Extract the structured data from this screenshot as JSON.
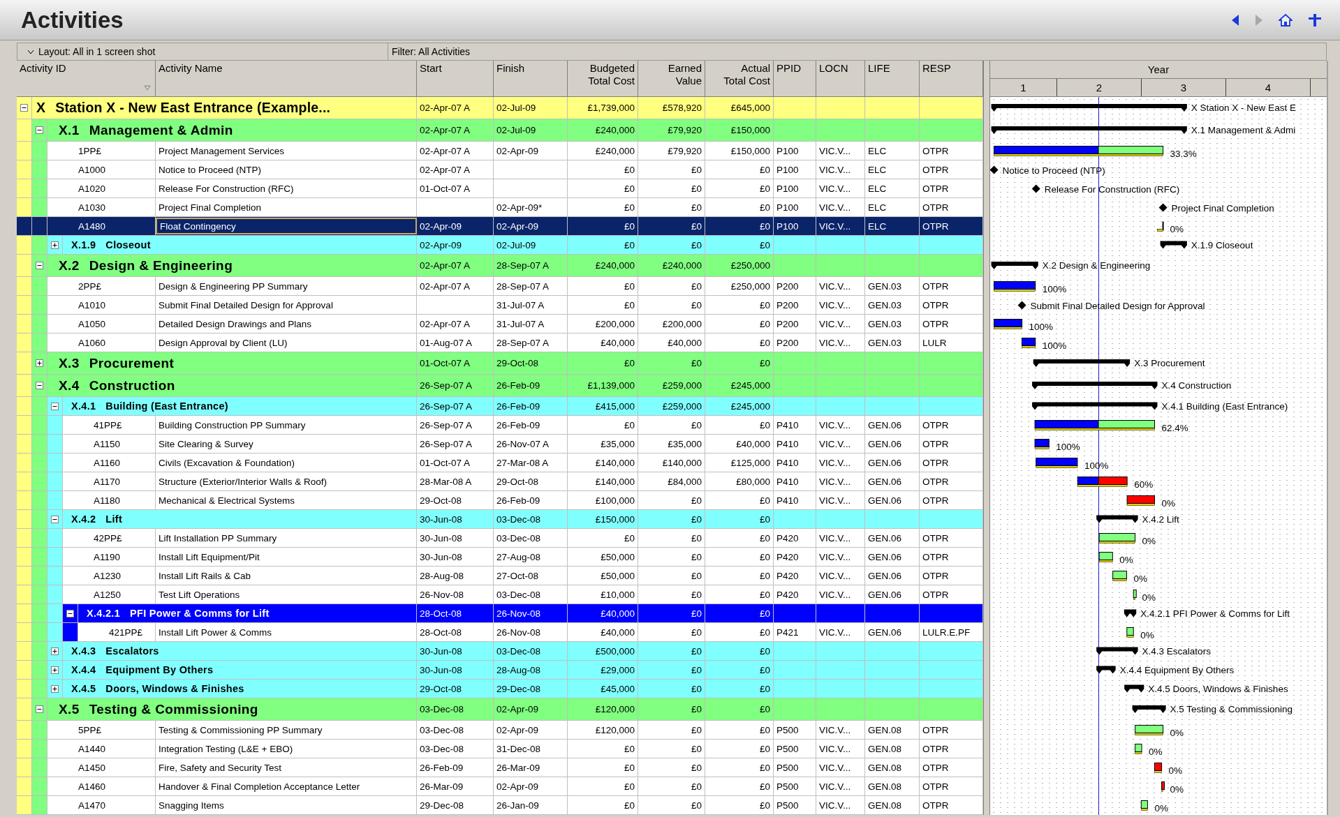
{
  "title": "Activities",
  "toolbar": {
    "layout": "Layout: All in 1 screen shot",
    "filter": "Filter: All Activities"
  },
  "columns": [
    {
      "lines": [
        "Activity ID"
      ]
    },
    {
      "lines": [
        "Activity Name"
      ]
    },
    {
      "lines": [
        "Start"
      ]
    },
    {
      "lines": [
        "Finish"
      ]
    },
    {
      "lines": [
        "Budgeted",
        "Total Cost"
      ]
    },
    {
      "lines": [
        "Earned",
        "Value"
      ]
    },
    {
      "lines": [
        "Actual",
        "Total Cost"
      ]
    },
    {
      "lines": [
        "PPID"
      ]
    },
    {
      "lines": [
        "LOCN"
      ]
    },
    {
      "lines": [
        "LIFE"
      ]
    },
    {
      "lines": [
        "RESP"
      ]
    }
  ],
  "timescale": {
    "title": "Year",
    "ticks": [
      "1",
      "2",
      "3",
      "4"
    ]
  },
  "activities": [
    {
      "kind": "wbs",
      "code": "X",
      "name": "Station X - New East Entrance (Example...",
      "start": "02-Apr-07 A",
      "finish": "02-Jul-09",
      "budgeted": "£1,739,000",
      "earned": "£578,920",
      "actual": "£645,000",
      "expanded": true,
      "selected": false,
      "bar": {
        "kind": "summary",
        "label": "X Station X - New East E"
      },
      "children": [
        {
          "kind": "wbs",
          "code": "X.1",
          "name": "Management & Admin",
          "start": "02-Apr-07 A",
          "finish": "02-Jul-09",
          "budgeted": "£240,000",
          "earned": "£79,920",
          "actual": "£150,000",
          "expanded": true,
          "selected": false,
          "bar": {
            "kind": "summary",
            "label": "X.1 Management & Admi"
          },
          "children": [
            {
              "kind": "task",
              "id": "1PP£",
              "name": "Project Management Services",
              "start": "02-Apr-07 A",
              "finish": "02-Apr-09",
              "budgeted": "£240,000",
              "earned": "£79,920",
              "actual": "£150,000",
              "ppid": "P100",
              "locn": "VIC.V...",
              "life": "ELC",
              "resp": "OTPR",
              "selected": false,
              "bar": {
                "kind": "task",
                "label": "33.3%"
              }
            },
            {
              "kind": "task",
              "id": "A1000",
              "name": "Notice to Proceed (NTP)",
              "start": "02-Apr-07 A",
              "budgeted": "£0",
              "earned": "£0",
              "actual": "£0",
              "ppid": "P100",
              "locn": "VIC.V...",
              "life": "ELC",
              "resp": "OTPR",
              "selected": false,
              "bar": {
                "kind": "milestone",
                "label": "Notice to Proceed (NTP)"
              }
            },
            {
              "kind": "task",
              "id": "A1020",
              "name": "Release For Construction (RFC)",
              "start": "01-Oct-07 A",
              "budgeted": "£0",
              "earned": "£0",
              "actual": "£0",
              "ppid": "P100",
              "locn": "VIC.V...",
              "life": "ELC",
              "resp": "OTPR",
              "selected": false,
              "bar": {
                "kind": "milestone",
                "label": "Release For Construction (RFC)"
              }
            },
            {
              "kind": "task",
              "id": "A1030",
              "name": "Project Final Completion",
              "finish": "02-Apr-09*",
              "budgeted": "£0",
              "earned": "£0",
              "actual": "£0",
              "ppid": "P100",
              "locn": "VIC.V...",
              "life": "ELC",
              "resp": "OTPR",
              "selected": false,
              "bar": {
                "kind": "milestone",
                "label": "Project Final Completion"
              }
            },
            {
              "kind": "task",
              "id": "A1480",
              "name": "Float Contingency",
              "start": "02-Apr-09",
              "finish": "02-Apr-09",
              "budgeted": "£0",
              "earned": "£0",
              "actual": "£0",
              "ppid": "P100",
              "locn": "VIC.V...",
              "life": "ELC",
              "resp": "OTPR",
              "selected": true,
              "bar": {
                "kind": "task",
                "label": "0%"
              }
            },
            {
              "kind": "wbs",
              "code": "X.1.9",
              "name": "Closeout",
              "start": "02-Apr-09",
              "finish": "02-Jul-09",
              "budgeted": "£0",
              "earned": "£0",
              "actual": "£0",
              "expanded": false,
              "selected": false,
              "bar": {
                "kind": "summary",
                "label": "X.1.9 Closeout"
              }
            }
          ]
        },
        {
          "kind": "wbs",
          "code": "X.2",
          "name": "Design & Engineering",
          "start": "02-Apr-07 A",
          "finish": "28-Sep-07 A",
          "budgeted": "£240,000",
          "earned": "£240,000",
          "actual": "£250,000",
          "expanded": true,
          "selected": false,
          "bar": {
            "kind": "summary",
            "label": "X.2 Design & Engineering"
          },
          "children": [
            {
              "kind": "task",
              "id": "2PP£",
              "name": "Design & Engineering PP Summary",
              "start": "02-Apr-07 A",
              "finish": "28-Sep-07 A",
              "budgeted": "£0",
              "earned": "£0",
              "actual": "£250,000",
              "ppid": "P200",
              "locn": "VIC.V...",
              "life": "GEN.03",
              "resp": "OTPR",
              "selected": false,
              "bar": {
                "kind": "task",
                "label": "100%"
              }
            },
            {
              "kind": "task",
              "id": "A1010",
              "name": "Submit Final Detailed Design for Approval",
              "finish": "31-Jul-07 A",
              "budgeted": "£0",
              "earned": "£0",
              "actual": "£0",
              "ppid": "P200",
              "locn": "VIC.V...",
              "life": "GEN.03",
              "resp": "OTPR",
              "selected": false,
              "bar": {
                "kind": "milestone",
                "label": "Submit Final Detailed Design for Approval"
              }
            },
            {
              "kind": "task",
              "id": "A1050",
              "name": "Detailed Design Drawings and Plans",
              "start": "02-Apr-07 A",
              "finish": "31-Jul-07 A",
              "budgeted": "£200,000",
              "earned": "£200,000",
              "actual": "£0",
              "ppid": "P200",
              "locn": "VIC.V...",
              "life": "GEN.03",
              "resp": "OTPR",
              "selected": false,
              "bar": {
                "kind": "task",
                "label": "100%"
              }
            },
            {
              "kind": "task",
              "id": "A1060",
              "name": "Design Approval by Client (LU)",
              "start": "01-Aug-07 A",
              "finish": "28-Sep-07 A",
              "budgeted": "£40,000",
              "earned": "£40,000",
              "actual": "£0",
              "ppid": "P200",
              "locn": "VIC.V...",
              "life": "GEN.03",
              "resp": "LULR",
              "selected": false,
              "bar": {
                "kind": "task",
                "label": "100%"
              }
            }
          ]
        },
        {
          "kind": "wbs",
          "code": "X.3",
          "name": "Procurement",
          "start": "01-Oct-07 A",
          "finish": "29-Oct-08",
          "budgeted": "£0",
          "earned": "£0",
          "actual": "£0",
          "expanded": false,
          "selected": false,
          "bar": {
            "kind": "summary",
            "label": "X.3 Procurement"
          }
        },
        {
          "kind": "wbs",
          "code": "X.4",
          "name": "Construction",
          "start": "26-Sep-07 A",
          "finish": "26-Feb-09",
          "budgeted": "£1,139,000",
          "earned": "£259,000",
          "actual": "£245,000",
          "expanded": true,
          "selected": false,
          "bar": {
            "kind": "summary",
            "label": "X.4 Construction"
          },
          "children": [
            {
              "kind": "wbs",
              "code": "X.4.1",
              "name": "Building (East Entrance)",
              "start": "26-Sep-07 A",
              "finish": "26-Feb-09",
              "budgeted": "£415,000",
              "earned": "£259,000",
              "actual": "£245,000",
              "expanded": true,
              "selected": false,
              "bar": {
                "kind": "summary",
                "label": "X.4.1 Building (East Entrance)"
              },
              "children": [
                {
                  "kind": "task",
                  "id": "41PP£",
                  "name": "Building Construction PP Summary",
                  "start": "26-Sep-07 A",
                  "finish": "26-Feb-09",
                  "budgeted": "£0",
                  "earned": "£0",
                  "actual": "£0",
                  "ppid": "P410",
                  "locn": "VIC.V...",
                  "life": "GEN.06",
                  "resp": "OTPR",
                  "selected": false,
                  "bar": {
                    "kind": "task",
                    "label": "62.4%"
                  }
                },
                {
                  "kind": "task",
                  "id": "A1150",
                  "name": "Site Clearing & Survey",
                  "start": "26-Sep-07 A",
                  "finish": "26-Nov-07 A",
                  "budgeted": "£35,000",
                  "earned": "£35,000",
                  "actual": "£40,000",
                  "ppid": "P410",
                  "locn": "VIC.V...",
                  "life": "GEN.06",
                  "resp": "OTPR",
                  "selected": false,
                  "bar": {
                    "kind": "task",
                    "label": "100%"
                  }
                },
                {
                  "kind": "task",
                  "id": "A1160",
                  "name": "Civils (Excavation & Foundation)",
                  "start": "01-Oct-07 A",
                  "finish": "27-Mar-08 A",
                  "budgeted": "£140,000",
                  "earned": "£140,000",
                  "actual": "£125,000",
                  "ppid": "P410",
                  "locn": "VIC.V...",
                  "life": "GEN.06",
                  "resp": "OTPR",
                  "selected": false,
                  "bar": {
                    "kind": "task",
                    "label": "100%"
                  }
                },
                {
                  "kind": "task",
                  "id": "A1170",
                  "name": "Structure (Exterior/Interior Walls & Roof)",
                  "start": "28-Mar-08 A",
                  "finish": "29-Oct-08",
                  "budgeted": "£140,000",
                  "earned": "£84,000",
                  "actual": "£80,000",
                  "ppid": "P410",
                  "locn": "VIC.V...",
                  "life": "GEN.06",
                  "resp": "OTPR",
                  "selected": false,
                  "bar": {
                    "kind": "task",
                    "label": "60%",
                    "critical": true
                  }
                },
                {
                  "kind": "task",
                  "id": "A1180",
                  "name": "Mechanical & Electrical Systems",
                  "start": "29-Oct-08",
                  "finish": "26-Feb-09",
                  "budgeted": "£100,000",
                  "earned": "£0",
                  "actual": "£0",
                  "ppid": "P410",
                  "locn": "VIC.V...",
                  "life": "GEN.06",
                  "resp": "OTPR",
                  "selected": false,
                  "bar": {
                    "kind": "task",
                    "label": "0%",
                    "critical": true
                  }
                }
              ]
            },
            {
              "kind": "wbs",
              "code": "X.4.2",
              "name": "Lift",
              "start": "30-Jun-08",
              "finish": "03-Dec-08",
              "budgeted": "£150,000",
              "earned": "£0",
              "actual": "£0",
              "expanded": true,
              "selected": false,
              "bar": {
                "kind": "summary",
                "label": "X.4.2 Lift"
              },
              "children": [
                {
                  "kind": "task",
                  "id": "42PP£",
                  "name": "Lift Installation PP Summary",
                  "start": "30-Jun-08",
                  "finish": "03-Dec-08",
                  "budgeted": "£0",
                  "earned": "£0",
                  "actual": "£0",
                  "ppid": "P420",
                  "locn": "VIC.V...",
                  "life": "GEN.06",
                  "resp": "OTPR",
                  "selected": false,
                  "bar": {
                    "kind": "task",
                    "label": "0%"
                  }
                },
                {
                  "kind": "task",
                  "id": "A1190",
                  "name": "Install Lift Equipment/Pit",
                  "start": "30-Jun-08",
                  "finish": "27-Aug-08",
                  "budgeted": "£50,000",
                  "earned": "£0",
                  "actual": "£0",
                  "ppid": "P420",
                  "locn": "VIC.V...",
                  "life": "GEN.06",
                  "resp": "OTPR",
                  "selected": false,
                  "bar": {
                    "kind": "task",
                    "label": "0%"
                  }
                },
                {
                  "kind": "task",
                  "id": "A1230",
                  "name": "Install Lift Rails & Cab",
                  "start": "28-Aug-08",
                  "finish": "27-Oct-08",
                  "budgeted": "£50,000",
                  "earned": "£0",
                  "actual": "£0",
                  "ppid": "P420",
                  "locn": "VIC.V...",
                  "life": "GEN.06",
                  "resp": "OTPR",
                  "selected": false,
                  "bar": {
                    "kind": "task",
                    "label": "0%"
                  }
                },
                {
                  "kind": "task",
                  "id": "A1250",
                  "name": "Test Lift Operations",
                  "start": "26-Nov-08",
                  "finish": "03-Dec-08",
                  "budgeted": "£10,000",
                  "earned": "£0",
                  "actual": "£0",
                  "ppid": "P420",
                  "locn": "VIC.V...",
                  "life": "GEN.06",
                  "resp": "OTPR",
                  "selected": false,
                  "bar": {
                    "kind": "task",
                    "label": "0%"
                  }
                },
                {
                  "kind": "wbs",
                  "code": "X.4.2.1",
                  "name": "PFI Power & Comms for Lift",
                  "start": "28-Oct-08",
                  "finish": "26-Nov-08",
                  "budgeted": "£40,000",
                  "earned": "£0",
                  "actual": "£0",
                  "expanded": true,
                  "selected": false,
                  "bar": {
                    "kind": "summary",
                    "label": "X.4.2.1 PFI Power & Comms for Lift"
                  },
                  "children": [
                    {
                      "kind": "task",
                      "id": "421PP£",
                      "name": "Install Lift Power & Comms",
                      "start": "28-Oct-08",
                      "finish": "26-Nov-08",
                      "budgeted": "£40,000",
                      "earned": "£0",
                      "actual": "£0",
                      "ppid": "P421",
                      "locn": "VIC.V...",
                      "life": "GEN.06",
                      "resp": "LULR.E.PF",
                      "selected": false,
                      "bar": {
                        "kind": "task",
                        "label": "0%"
                      }
                    }
                  ]
                }
              ]
            },
            {
              "kind": "wbs",
              "code": "X.4.3",
              "name": "Escalators",
              "start": "30-Jun-08",
              "finish": "03-Dec-08",
              "budgeted": "£500,000",
              "earned": "£0",
              "actual": "£0",
              "expanded": false,
              "selected": false,
              "bar": {
                "kind": "summary",
                "label": "X.4.3 Escalators"
              }
            },
            {
              "kind": "wbs",
              "code": "X.4.4",
              "name": "Equipment By Others",
              "start": "30-Jun-08",
              "finish": "28-Aug-08",
              "budgeted": "£29,000",
              "earned": "£0",
              "actual": "£0",
              "expanded": false,
              "selected": false,
              "bar": {
                "kind": "summary",
                "label": "X.4.4 Equipment By Others"
              }
            },
            {
              "kind": "wbs",
              "code": "X.4.5",
              "name": "Doors, Windows & Finishes",
              "start": "29-Oct-08",
              "finish": "29-Dec-08",
              "budgeted": "£45,000",
              "earned": "£0",
              "actual": "£0",
              "expanded": false,
              "selected": false,
              "bar": {
                "kind": "summary",
                "label": "X.4.5 Doors, Windows & Finishes"
              }
            }
          ]
        },
        {
          "kind": "wbs",
          "code": "X.5",
          "name": "Testing & Commissioning",
          "start": "03-Dec-08",
          "finish": "02-Apr-09",
          "budgeted": "£120,000",
          "earned": "£0",
          "actual": "£0",
          "expanded": true,
          "selected": false,
          "bar": {
            "kind": "summary",
            "label": "X.5 Testing & Commissioning"
          },
          "children": [
            {
              "kind": "task",
              "id": "5PP£",
              "name": "Testing & Commissioning PP Summary",
              "start": "03-Dec-08",
              "finish": "02-Apr-09",
              "budgeted": "£120,000",
              "earned": "£0",
              "actual": "£0",
              "ppid": "P500",
              "locn": "VIC.V...",
              "life": "GEN.08",
              "resp": "OTPR",
              "selected": false,
              "bar": {
                "kind": "task",
                "label": "0%"
              }
            },
            {
              "kind": "task",
              "id": "A1440",
              "name": "Integration Testing (L&E + EBO)",
              "start": "03-Dec-08",
              "finish": "31-Dec-08",
              "budgeted": "£0",
              "earned": "£0",
              "actual": "£0",
              "ppid": "P500",
              "locn": "VIC.V...",
              "life": "GEN.08",
              "resp": "OTPR",
              "selected": false,
              "bar": {
                "kind": "task",
                "label": "0%"
              }
            },
            {
              "kind": "task",
              "id": "A1450",
              "name": "Fire, Safety and Security Test",
              "start": "26-Feb-09",
              "finish": "26-Mar-09",
              "budgeted": "£0",
              "earned": "£0",
              "actual": "£0",
              "ppid": "P500",
              "locn": "VIC.V...",
              "life": "GEN.08",
              "resp": "OTPR",
              "selected": false,
              "bar": {
                "kind": "task",
                "label": "0%",
                "critical": true
              }
            },
            {
              "kind": "task",
              "id": "A1460",
              "name": "Handover & Final Completion Acceptance Letter",
              "start": "26-Mar-09",
              "finish": "02-Apr-09",
              "budgeted": "£0",
              "earned": "£0",
              "actual": "£0",
              "ppid": "P500",
              "locn": "VIC.V...",
              "life": "GEN.08",
              "resp": "OTPR",
              "selected": false,
              "bar": {
                "kind": "task",
                "label": "0%",
                "critical": true
              }
            },
            {
              "kind": "task",
              "id": "A1470",
              "name": "Snagging Items",
              "start": "29-Dec-08",
              "finish": "26-Jan-09",
              "budgeted": "£0",
              "earned": "£0",
              "actual": "£0",
              "ppid": "P500",
              "locn": "VIC.V...",
              "life": "GEN.08",
              "resp": "OTPR",
              "selected": false,
              "bar": {
                "kind": "task",
                "label": "0%"
              }
            }
          ]
        }
      ]
    }
  ]
}
